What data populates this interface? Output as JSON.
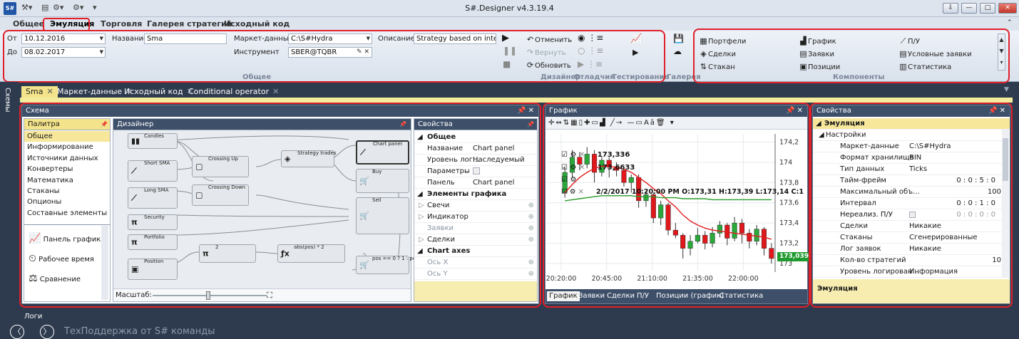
{
  "window": {
    "title": "S#.Designer v4.3.19.4",
    "logo": "S#"
  },
  "ribbon": {
    "tabs": [
      "Общее",
      "Эмуляция",
      "Торговля",
      "Галерея стратегий",
      "Исходный код"
    ],
    "active_tab": "Эмуляция",
    "from_label": "От",
    "from_value": "10.12.2016",
    "to_label": "До",
    "to_value": "08.02.2017",
    "name_label": "Название",
    "name_value": "Sma",
    "market_data_label": "Маркет-данные",
    "market_data_value": "C:\\S#Hydra",
    "instrument_label": "Инструмент",
    "instrument_value": "SBER@TQBR",
    "description_label": "Описание",
    "description_value": "Strategy based on intersect",
    "group_general": "Общее",
    "undo": "Отменить",
    "redo": "Вернуть",
    "refresh": "Обновить",
    "group_designer": "Дизайнер",
    "group_debugger": "Отладчик",
    "group_testing": "Тестирование",
    "group_gallery": "Галерея",
    "components": [
      "Портфели",
      "Сделки",
      "Стакан",
      "График",
      "Заявки",
      "Позиции",
      "П/У",
      "Условные заявки",
      "Статистика"
    ],
    "group_components": "Компоненты"
  },
  "side_strip": "Схемы",
  "doc_tabs": [
    "Sma",
    "Маркет-данные",
    "Исходный код",
    "Conditional operator"
  ],
  "schema": {
    "title": "Схема",
    "palette_title": "Палитра",
    "palette_items": [
      "Общее",
      "Информирование",
      "Источники данных",
      "Конвертеры",
      "Математика",
      "Стаканы",
      "Опционы",
      "Составные элементы"
    ],
    "palette_elements": [
      "Панель графика",
      "Рабочее время",
      "Сравнение"
    ],
    "designer_title": "Дизайнер",
    "zoom_label": "Масштаб:",
    "nodes": [
      "Candles",
      "Short SMA",
      "Long SMA",
      "Crossing Up",
      "Crossing Down",
      "Strategy trades",
      "Chart panel",
      "Buy",
      "Sell",
      "Security",
      "Portfolio",
      "Position",
      "2",
      "abs(pos) * 2",
      "pos == 0 ? 1 : pos"
    ],
    "props_title": "Свойства",
    "props": {
      "general": "Общее",
      "name_k": "Название",
      "name_v": "Chart panel",
      "log_k": "Уровень лог...",
      "log_v": "Наследуемый",
      "params_k": "Параметры",
      "panel_k": "Панель",
      "panel_v": "Chart panel",
      "chart_elements": "Элементы графика",
      "candles": "Свечи",
      "indicator": "Индикатор",
      "orders": "Заявки",
      "trades": "Сделки",
      "chart_axes": "Chart axes",
      "axis_x": "Ось X",
      "axis_y": "Ось Y"
    }
  },
  "chart": {
    "title": "График",
    "legend": [
      "173,336",
      "173,6633",
      "2/2/2017 10:20:00 PM O:173,31 H:173,39 L:173,14 C:173,1"
    ],
    "price_badge": "173,039",
    "bottom_tabs": [
      "График",
      "Заявки",
      "Сделки",
      "П/У",
      "Позиции (график)",
      "Статистика"
    ]
  },
  "chart_data": {
    "type": "candlestick",
    "x_ticks": [
      "20:20:00",
      "20:45:00",
      "21:10:00",
      "21:35:00",
      "22:00:00"
    ],
    "y_ticks": [
      174.2,
      174,
      173.8,
      173.6,
      173.4,
      173.2,
      173
    ],
    "ylim": [
      172.93,
      174.28
    ],
    "candles": [
      {
        "o": 173.7,
        "c": 173.9,
        "h": 173.95,
        "l": 173.65
      },
      {
        "o": 173.9,
        "c": 174.05,
        "h": 174.12,
        "l": 173.85
      },
      {
        "o": 174.05,
        "c": 173.98,
        "h": 174.1,
        "l": 173.92
      },
      {
        "o": 173.98,
        "c": 174.08,
        "h": 174.15,
        "l": 173.94
      },
      {
        "o": 174.08,
        "c": 173.9,
        "h": 174.12,
        "l": 173.8
      },
      {
        "o": 173.9,
        "c": 174.02,
        "h": 174.06,
        "l": 173.86
      },
      {
        "o": 174.02,
        "c": 173.95,
        "h": 174.05,
        "l": 173.85
      },
      {
        "o": 173.95,
        "c": 173.92,
        "h": 174.0,
        "l": 173.86
      },
      {
        "o": 173.92,
        "c": 173.8,
        "h": 173.95,
        "l": 173.76
      },
      {
        "o": 173.8,
        "c": 173.85,
        "h": 173.88,
        "l": 173.7
      },
      {
        "o": 173.85,
        "c": 173.62,
        "h": 173.88,
        "l": 173.55
      },
      {
        "o": 173.62,
        "c": 173.68,
        "h": 173.72,
        "l": 173.56
      },
      {
        "o": 173.68,
        "c": 173.45,
        "h": 173.7,
        "l": 173.4
      },
      {
        "o": 173.45,
        "c": 173.58,
        "h": 173.62,
        "l": 173.38
      },
      {
        "o": 173.58,
        "c": 173.33,
        "h": 173.6,
        "l": 173.28
      },
      {
        "o": 173.33,
        "c": 173.28,
        "h": 173.4,
        "l": 173.25
      },
      {
        "o": 173.28,
        "c": 173.15,
        "h": 173.3,
        "l": 173.05
      },
      {
        "o": 173.15,
        "c": 173.22,
        "h": 173.28,
        "l": 173.08
      },
      {
        "o": 173.22,
        "c": 173.28,
        "h": 173.35,
        "l": 173.2
      },
      {
        "o": 173.28,
        "c": 173.2,
        "h": 173.32,
        "l": 173.14
      },
      {
        "o": 173.2,
        "c": 173.3,
        "h": 173.36,
        "l": 173.16
      },
      {
        "o": 173.3,
        "c": 173.38,
        "h": 173.42,
        "l": 173.26
      },
      {
        "o": 173.38,
        "c": 173.25,
        "h": 173.4,
        "l": 173.18
      },
      {
        "o": 173.25,
        "c": 173.4,
        "h": 173.46,
        "l": 173.22
      },
      {
        "o": 173.4,
        "c": 173.3,
        "h": 173.44,
        "l": 173.2
      },
      {
        "o": 173.3,
        "c": 173.22,
        "h": 173.34,
        "l": 173.15
      },
      {
        "o": 173.22,
        "c": 173.34,
        "h": 173.38,
        "l": 173.18
      },
      {
        "o": 173.34,
        "c": 173.15,
        "h": 173.36,
        "l": 173.08
      },
      {
        "o": 173.15,
        "c": 173.05,
        "h": 173.2,
        "l": 173.0
      }
    ],
    "series": [
      {
        "values": [
          173.7,
          173.78,
          173.85,
          173.9,
          173.94,
          173.96,
          173.96,
          173.95,
          173.93,
          173.9,
          173.85,
          173.8,
          173.74,
          173.69,
          173.62,
          173.56,
          173.48,
          173.42,
          173.38,
          173.35,
          173.33,
          173.32,
          173.31,
          173.3,
          173.29,
          173.28,
          173.27,
          173.26,
          173.24
        ]
      },
      {
        "values": [
          173.62,
          173.63,
          173.64,
          173.65,
          173.66,
          173.67,
          173.67,
          173.67,
          173.67,
          173.67,
          173.66,
          173.66,
          173.66,
          173.65,
          173.65,
          173.65,
          173.64,
          173.64,
          173.64,
          173.64,
          173.63,
          173.63,
          173.63,
          173.63,
          173.63,
          173.63,
          173.63,
          173.63,
          173.63
        ]
      }
    ],
    "colors": {
      "up": "#2aa83a",
      "down": "#e0181b",
      "ma1": "#e21e1e",
      "ma2": "#2a9a2a"
    }
  },
  "properties": {
    "title": "Свойства",
    "section": "Эмуляция",
    "subsection": "Настройки",
    "rows": [
      {
        "k": "Маркет-данные",
        "v": "C:\\S#Hydra"
      },
      {
        "k": "Формат хранилища",
        "v": "BIN"
      },
      {
        "k": "Тип данных",
        "v": "Ticks"
      },
      {
        "k": "Тайм-фрейм",
        "v": "0 : 0 : 5 : 0"
      },
      {
        "k": "Максимальный объ...",
        "v": "100"
      },
      {
        "k": "Интервал",
        "v": "0 : 0 : 1 : 0"
      },
      {
        "k": "Нереализ. П/У",
        "v": "0 : 0 : 0 : 0"
      },
      {
        "k": "Сделки",
        "v": "Никакие"
      },
      {
        "k": "Стаканы",
        "v": "Сгенерированные"
      },
      {
        "k": "Лог заявок",
        "v": "Никакие"
      },
      {
        "k": "Кол-во стратегий",
        "v": "10"
      },
      {
        "k": "Уровень логирован...",
        "v": "Информация"
      }
    ],
    "footer": "Эмуляция"
  },
  "bottom": {
    "logs": "Логи",
    "support": "ТехПоддержка от S# команды"
  },
  "colors": {
    "accent_red": "#e0202a",
    "dark": "#2e3b4e",
    "header": "#3e4f6a",
    "selection": "#f7e79b"
  }
}
